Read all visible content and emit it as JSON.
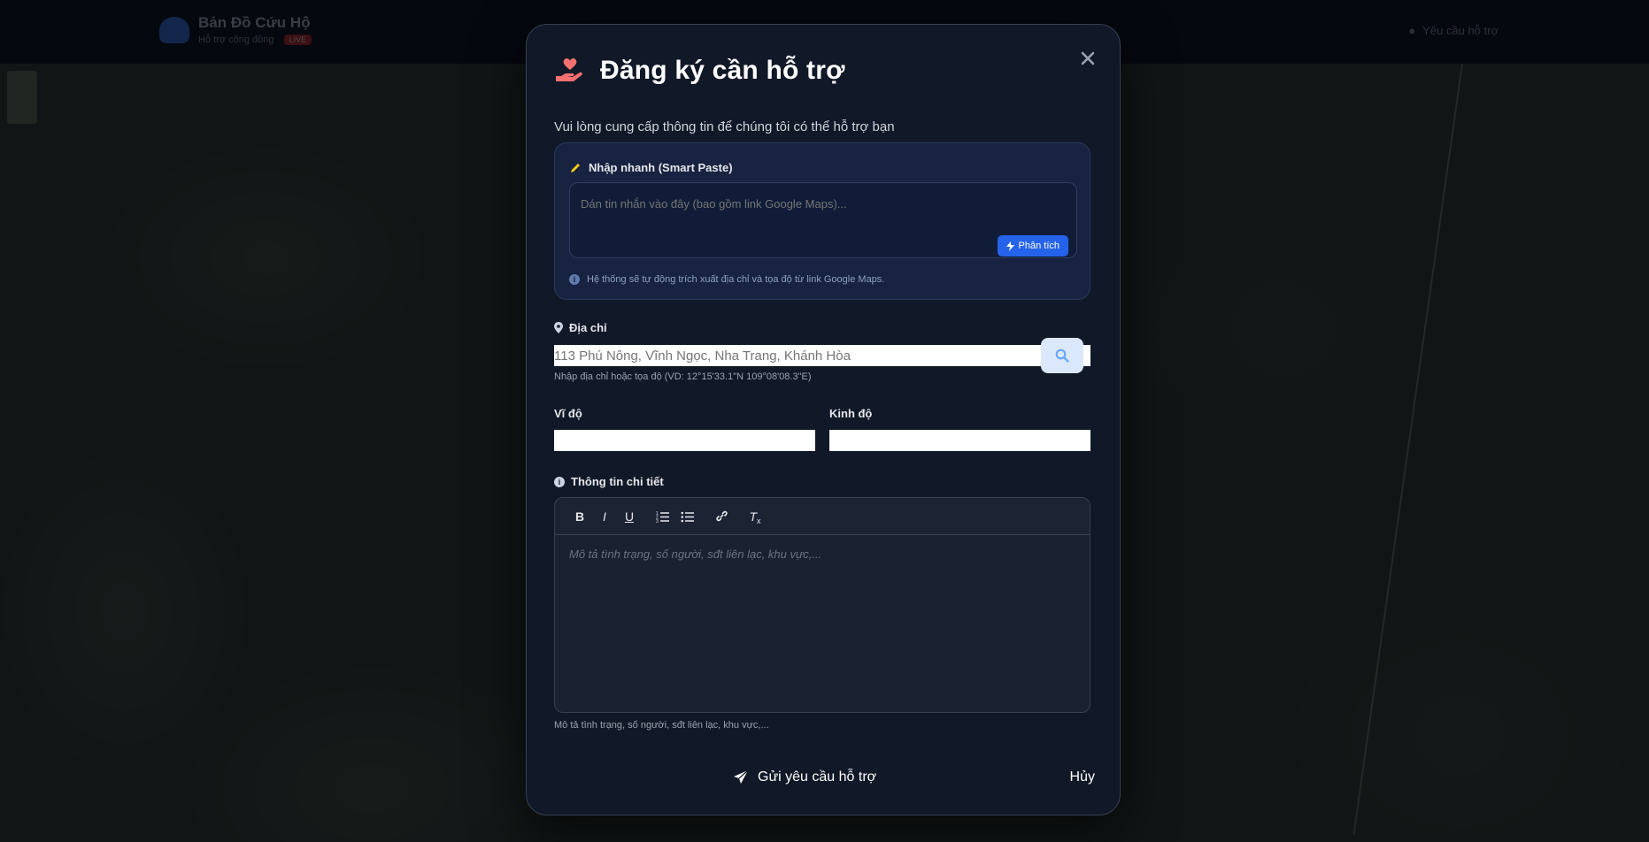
{
  "app": {
    "brand_title": "Bản Đồ Cứu Hộ",
    "brand_subtitle": "Hỗ trợ cộng đồng",
    "brand_badge": "LIVE",
    "top_link": "Yêu cầu hỗ trợ"
  },
  "modal": {
    "title": "Đăng ký cần hỗ trợ",
    "subtitle": "Vui lòng cung cấp thông tin để chúng tôi có thể hỗ trợ bạn",
    "smart_paste": {
      "heading": "Nhập nhanh (Smart Paste)",
      "placeholder": "Dán tin nhắn vào đây (bao gồm link Google Maps)...",
      "analyze_label": "Phân tích",
      "hint": "Hệ thống sẽ tự động trích xuất địa chỉ và tọa độ từ link Google Maps."
    },
    "address": {
      "label": "Địa chỉ",
      "placeholder": "113 Phú Nông, Vĩnh Ngọc, Nha Trang, Khánh Hòa",
      "hint": "Nhập địa chỉ hoặc tọa độ (VD: 12°15'33.1\"N 109°08'08.3\"E)"
    },
    "latitude": {
      "label": "Vĩ độ",
      "value": ""
    },
    "longitude": {
      "label": "Kinh độ",
      "value": ""
    },
    "details": {
      "label": "Thông tin chi tiết",
      "placeholder": "Mô tả tình trạng, số người, sđt liên lạc, khu vực,...",
      "hint": "Mô tả tình trạng, số người, sđt liên lạc, khu vực,..."
    },
    "toolbar": {
      "bold": "B",
      "italic": "I",
      "underline": "U",
      "clean": "T"
    },
    "submit_label": "Gửi yêu cầu hỗ trợ",
    "cancel_label": "Hủy",
    "close_label": "✕"
  },
  "colors": {
    "modal_bg": "#111827",
    "accent_blue": "#2563eb",
    "icon_red": "#f87171",
    "pencil_yellow": "#facc15"
  }
}
